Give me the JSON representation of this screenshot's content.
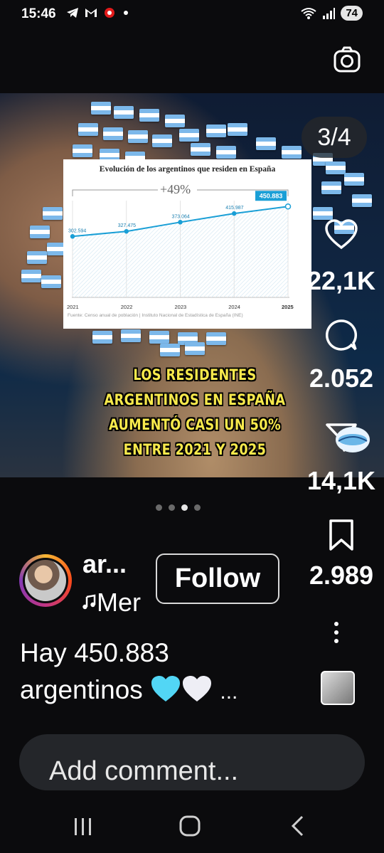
{
  "status_bar": {
    "time": "15:46",
    "battery": "74"
  },
  "media": {
    "counter": "3/4",
    "chart": {
      "title": "Evolución de los argentinos que residen en España",
      "growth_label": "+49%",
      "source": "Fuente: Censo anual de población | Instituto Nacional de Estadística de España (INE)"
    },
    "caption_lines": [
      "LOS  RESIDENTES",
      "ARGENTINOS  EN  ESPAÑA",
      "AUMENTÓ  CASI  UN  50%",
      "ENTRE  2021  Y  2025"
    ]
  },
  "chart_data": {
    "type": "area",
    "title": "Evolución de los argentinos que residen en España",
    "categories": [
      "2021",
      "2022",
      "2023",
      "2024",
      "2025"
    ],
    "value_labels": [
      "302.594",
      "327.475",
      "373.064",
      "415.987",
      "450.883"
    ],
    "values": [
      302594,
      327475,
      373064,
      415987,
      450883
    ],
    "ylim": [
      0,
      480000
    ],
    "grid": true,
    "highlight_last": true,
    "accent": "#1a9fd6"
  },
  "actions": {
    "likes": "22,1K",
    "comments": "2.052",
    "shares": "14,1K",
    "saves": "2.989"
  },
  "post": {
    "username": "ar...",
    "music": "Mer",
    "follow_label": "Follow",
    "description_line1": "Hay 450.883",
    "description_line2": "argentinos",
    "description_more": "..."
  },
  "comment": {
    "placeholder": "Add comment..."
  },
  "carousel": {
    "total": 4,
    "active": 3
  },
  "colors": {
    "caption_yellow": "#f7e94c",
    "background": "#0b0b0d",
    "chart_accent": "#1a9fd6"
  }
}
